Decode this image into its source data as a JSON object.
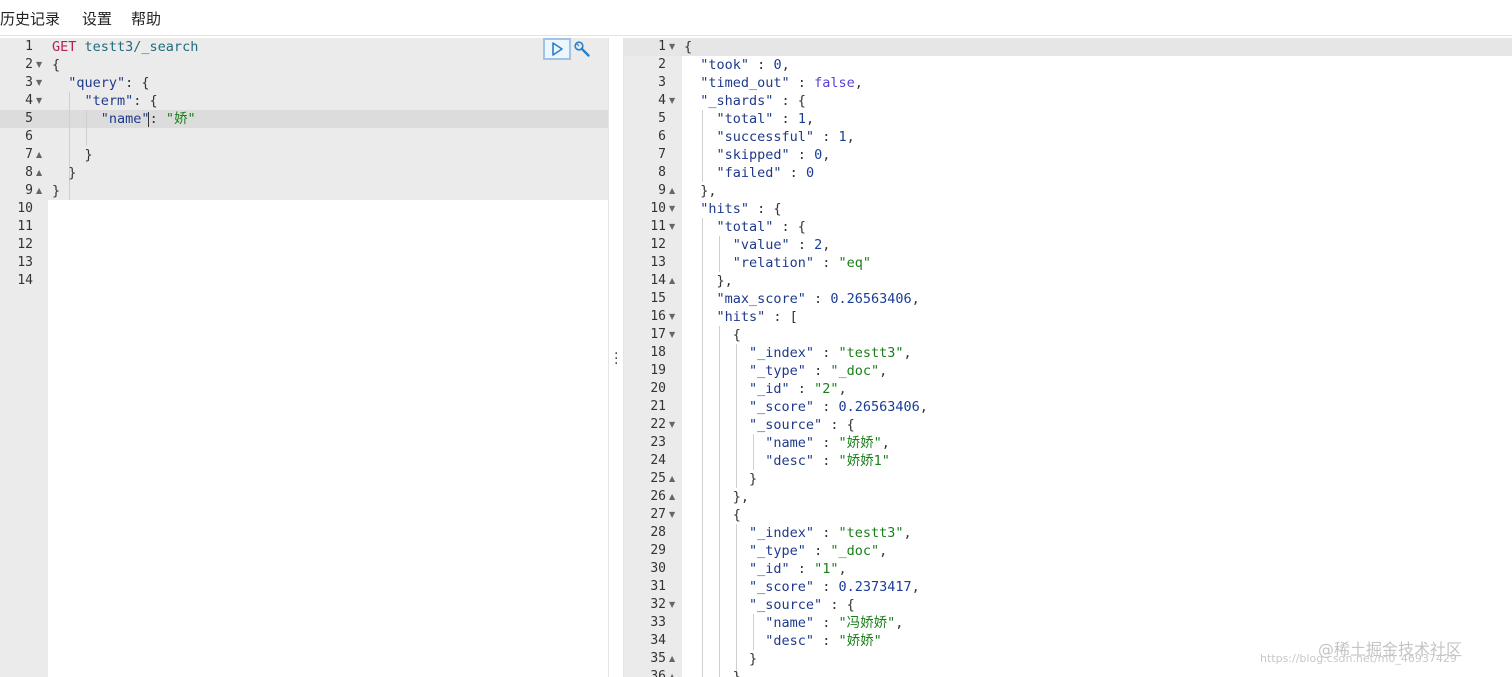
{
  "menu": {
    "history": "历史记录",
    "settings": "设置",
    "help": "帮助"
  },
  "request": {
    "lines": [
      [
        [
          "m",
          "GET"
        ],
        [
          "p",
          " "
        ],
        [
          "u",
          "testt3/_search"
        ]
      ],
      [
        [
          "p",
          "{"
        ]
      ],
      [
        [
          "p",
          "  "
        ],
        [
          "k",
          "\"query\""
        ],
        [
          "p",
          ": {"
        ]
      ],
      [
        [
          "p",
          "    "
        ],
        [
          "k",
          "\"term\""
        ],
        [
          "p",
          ": {"
        ]
      ],
      [
        [
          "p",
          "      "
        ],
        [
          "k",
          "\"name\""
        ],
        [
          "p",
          ": "
        ],
        [
          "s",
          "\"娇\""
        ]
      ],
      [
        [
          "p",
          ""
        ]
      ],
      [
        [
          "p",
          "    }"
        ]
      ],
      [
        [
          "p",
          "  }"
        ]
      ],
      [
        [
          "p",
          "}"
        ]
      ],
      [
        [
          "p",
          ""
        ]
      ],
      [
        [
          "p",
          ""
        ]
      ],
      [
        [
          "p",
          ""
        ]
      ],
      [
        [
          "p",
          ""
        ]
      ],
      [
        [
          "p",
          ""
        ]
      ]
    ],
    "folds": {
      "2": "down",
      "3": "down",
      "4": "down",
      "7": "up",
      "8": "up",
      "9": "up"
    }
  },
  "response": {
    "lines": [
      [
        [
          "p",
          "{"
        ]
      ],
      [
        [
          "p",
          "  "
        ],
        [
          "k",
          "\"took\""
        ],
        [
          "p",
          " : "
        ],
        [
          "n",
          "0"
        ],
        [
          "p",
          ","
        ]
      ],
      [
        [
          "p",
          "  "
        ],
        [
          "k",
          "\"timed_out\""
        ],
        [
          "p",
          " : "
        ],
        [
          "b",
          "false"
        ],
        [
          "p",
          ","
        ]
      ],
      [
        [
          "p",
          "  "
        ],
        [
          "k",
          "\"_shards\""
        ],
        [
          "p",
          " : {"
        ]
      ],
      [
        [
          "p",
          "    "
        ],
        [
          "k",
          "\"total\""
        ],
        [
          "p",
          " : "
        ],
        [
          "n",
          "1"
        ],
        [
          "p",
          ","
        ]
      ],
      [
        [
          "p",
          "    "
        ],
        [
          "k",
          "\"successful\""
        ],
        [
          "p",
          " : "
        ],
        [
          "n",
          "1"
        ],
        [
          "p",
          ","
        ]
      ],
      [
        [
          "p",
          "    "
        ],
        [
          "k",
          "\"skipped\""
        ],
        [
          "p",
          " : "
        ],
        [
          "n",
          "0"
        ],
        [
          "p",
          ","
        ]
      ],
      [
        [
          "p",
          "    "
        ],
        [
          "k",
          "\"failed\""
        ],
        [
          "p",
          " : "
        ],
        [
          "n",
          "0"
        ]
      ],
      [
        [
          "p",
          "  },"
        ]
      ],
      [
        [
          "p",
          "  "
        ],
        [
          "k",
          "\"hits\""
        ],
        [
          "p",
          " : {"
        ]
      ],
      [
        [
          "p",
          "    "
        ],
        [
          "k",
          "\"total\""
        ],
        [
          "p",
          " : {"
        ]
      ],
      [
        [
          "p",
          "      "
        ],
        [
          "k",
          "\"value\""
        ],
        [
          "p",
          " : "
        ],
        [
          "n",
          "2"
        ],
        [
          "p",
          ","
        ]
      ],
      [
        [
          "p",
          "      "
        ],
        [
          "k",
          "\"relation\""
        ],
        [
          "p",
          " : "
        ],
        [
          "s",
          "\"eq\""
        ]
      ],
      [
        [
          "p",
          "    },"
        ]
      ],
      [
        [
          "p",
          "    "
        ],
        [
          "k",
          "\"max_score\""
        ],
        [
          "p",
          " : "
        ],
        [
          "n",
          "0.26563406"
        ],
        [
          "p",
          ","
        ]
      ],
      [
        [
          "p",
          "    "
        ],
        [
          "k",
          "\"hits\""
        ],
        [
          "p",
          " : ["
        ]
      ],
      [
        [
          "p",
          "      {"
        ]
      ],
      [
        [
          "p",
          "        "
        ],
        [
          "k",
          "\"_index\""
        ],
        [
          "p",
          " : "
        ],
        [
          "s",
          "\"testt3\""
        ],
        [
          "p",
          ","
        ]
      ],
      [
        [
          "p",
          "        "
        ],
        [
          "k",
          "\"_type\""
        ],
        [
          "p",
          " : "
        ],
        [
          "s",
          "\"_doc\""
        ],
        [
          "p",
          ","
        ]
      ],
      [
        [
          "p",
          "        "
        ],
        [
          "k",
          "\"_id\""
        ],
        [
          "p",
          " : "
        ],
        [
          "s",
          "\"2\""
        ],
        [
          "p",
          ","
        ]
      ],
      [
        [
          "p",
          "        "
        ],
        [
          "k",
          "\"_score\""
        ],
        [
          "p",
          " : "
        ],
        [
          "n",
          "0.26563406"
        ],
        [
          "p",
          ","
        ]
      ],
      [
        [
          "p",
          "        "
        ],
        [
          "k",
          "\"_source\""
        ],
        [
          "p",
          " : {"
        ]
      ],
      [
        [
          "p",
          "          "
        ],
        [
          "k",
          "\"name\""
        ],
        [
          "p",
          " : "
        ],
        [
          "s",
          "\"娇娇\""
        ],
        [
          "p",
          ","
        ]
      ],
      [
        [
          "p",
          "          "
        ],
        [
          "k",
          "\"desc\""
        ],
        [
          "p",
          " : "
        ],
        [
          "s",
          "\"娇娇1\""
        ]
      ],
      [
        [
          "p",
          "        }"
        ]
      ],
      [
        [
          "p",
          "      },"
        ]
      ],
      [
        [
          "p",
          "      {"
        ]
      ],
      [
        [
          "p",
          "        "
        ],
        [
          "k",
          "\"_index\""
        ],
        [
          "p",
          " : "
        ],
        [
          "s",
          "\"testt3\""
        ],
        [
          "p",
          ","
        ]
      ],
      [
        [
          "p",
          "        "
        ],
        [
          "k",
          "\"_type\""
        ],
        [
          "p",
          " : "
        ],
        [
          "s",
          "\"_doc\""
        ],
        [
          "p",
          ","
        ]
      ],
      [
        [
          "p",
          "        "
        ],
        [
          "k",
          "\"_id\""
        ],
        [
          "p",
          " : "
        ],
        [
          "s",
          "\"1\""
        ],
        [
          "p",
          ","
        ]
      ],
      [
        [
          "p",
          "        "
        ],
        [
          "k",
          "\"_score\""
        ],
        [
          "p",
          " : "
        ],
        [
          "n",
          "0.2373417"
        ],
        [
          "p",
          ","
        ]
      ],
      [
        [
          "p",
          "        "
        ],
        [
          "k",
          "\"_source\""
        ],
        [
          "p",
          " : {"
        ]
      ],
      [
        [
          "p",
          "          "
        ],
        [
          "k",
          "\"name\""
        ],
        [
          "p",
          " : "
        ],
        [
          "s",
          "\"冯娇娇\""
        ],
        [
          "p",
          ","
        ]
      ],
      [
        [
          "p",
          "          "
        ],
        [
          "k",
          "\"desc\""
        ],
        [
          "p",
          " : "
        ],
        [
          "s",
          "\"娇娇\""
        ]
      ],
      [
        [
          "p",
          "        }"
        ]
      ],
      [
        [
          "p",
          "      }"
        ]
      ]
    ],
    "folds": {
      "1": "down",
      "4": "down",
      "9": "up",
      "10": "down",
      "11": "down",
      "14": "up",
      "16": "down",
      "17": "down",
      "22": "down",
      "25": "up",
      "26": "up",
      "27": "down",
      "32": "down",
      "35": "up",
      "36": "up"
    }
  },
  "watermark": {
    "brand": "@稀土掘金技术社区",
    "url": "https://blog.csdn.net/m0_46937429"
  },
  "icons": {
    "run": "play-icon",
    "wrench": "wrench-icon",
    "divider": "vertical-dots-icon"
  }
}
